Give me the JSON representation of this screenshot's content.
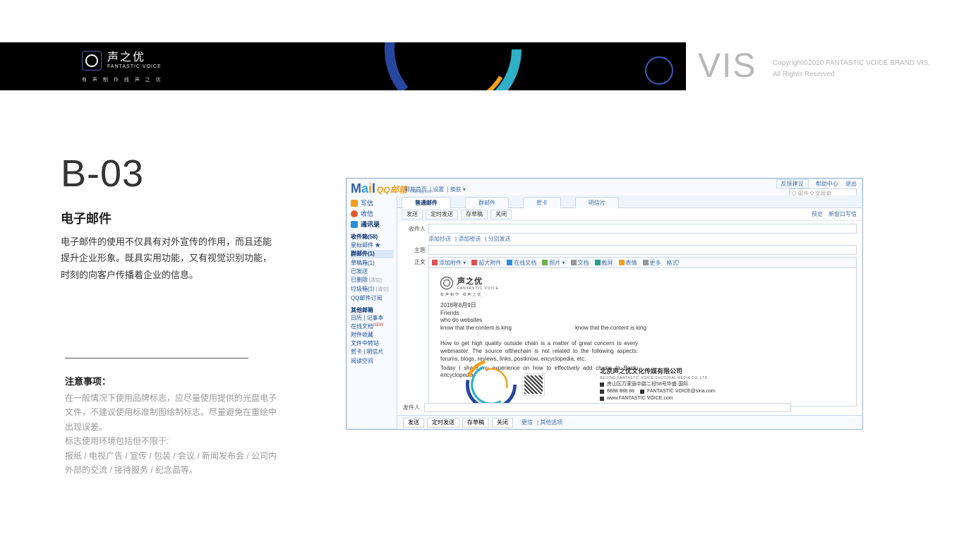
{
  "banner": {
    "brand_cn": "声之优",
    "brand_en": "FANTASTIC VOICE",
    "brand_tagline": "有 声 制 作  线 声 之 优"
  },
  "header": {
    "vis": "VIS",
    "copyright1": "Copyright©2020 FANTASTIC VOICE BRAND VIS.",
    "copyright2": "All Rights Reserved"
  },
  "page": {
    "code": "B-03",
    "title": "电子邮件",
    "desc": {
      "line1": "电子邮件的使用不仅具有对外宣传的作用，而且还能",
      "line2": "提升企业形象。既具实用功能，又有视觉识别功能，",
      "line3": "时刻的向客户传播着企业的信息。"
    },
    "notes": {
      "heading": "注意事项：",
      "p1": "在一般情况下使用品牌标志，应尽量使用提供的光盘电子文件，不建议使用标准制图绘制标志。尽量避免在重绘中出现误差。",
      "p2": "标志使用环境包括但不限于:",
      "p3": "报纸 / 电视广告 / 宣传 / 包装 / 会议 / 新闻发布会 / 公司内外部的交流 / 接待服务 / 纪念品等。"
    }
  },
  "mail": {
    "logo_cn": "QQ邮箱",
    "logo_sub": "mail.qq.com",
    "meta": [
      "邮箱首页",
      "设置",
      "换肤 ▾"
    ],
    "topbar": {
      "window": "反馈建议",
      "help": "帮助中心",
      "exit": "退出"
    },
    "search_placeholder": "Q 邮件全文搜索",
    "sidebar": {
      "actions": {
        "write": "写信",
        "inbox": "收信",
        "contacts": "通讯录"
      },
      "group1": [
        {
          "label": "收件箱(58)",
          "bold": true
        },
        {
          "label": "星标邮件 ★",
          "star": true
        },
        {
          "label": "群邮件(1)",
          "selected": true
        },
        {
          "label": "草稿箱(1)"
        },
        {
          "label": "已发送"
        },
        {
          "label": "已删除",
          "badge": "[清空]"
        },
        {
          "label": "垃圾箱(1)",
          "badge": "[清空]"
        },
        {
          "label": "QQ邮件订阅"
        }
      ],
      "section2_title": "其他邮箱",
      "group2": [
        {
          "label": "日历 | 记事本"
        },
        {
          "label": "在线文档",
          "new": "NEW"
        },
        {
          "label": "附件收藏"
        },
        {
          "label": "文件中转站"
        },
        {
          "label": "贺卡 | 明信片"
        },
        {
          "label": "阅读空间"
        }
      ]
    },
    "tabs": [
      "普通邮件",
      "群邮件",
      "贺卡",
      "明信片"
    ],
    "toolbar": {
      "send": "发送",
      "timed": "定时发送",
      "draft": "存草稿",
      "close": "关闭",
      "right1": "预览",
      "right2": "新窗口写信"
    },
    "form": {
      "to_label": "收件人",
      "sub_to": [
        "添加抄送",
        "添加密送",
        "分别发送"
      ],
      "subject_label": "主题",
      "body_label": "正文"
    },
    "editor_tools": {
      "t1": "添加附件 ▾",
      "t2": "超大附件",
      "t3": "在线文档",
      "t4": "照片 ▾",
      "t5": "文档",
      "t6": "截屏",
      "t7": "表情",
      "t8": "更多",
      "t9": "格式!"
    },
    "signature": {
      "brand_cn": "声之优",
      "brand_en": "FANTASTIC VOICE",
      "tagline": "有声制作 线声之优",
      "date": "2018年8月9日",
      "b1_l1": "Friends",
      "b1_l2": "who do websites",
      "b1_l3a": "know that the content is king",
      "b1_l3b": "know that the content is king",
      "para1": "How to get high quality outside chain is a matter of great concern to every webmaster. The source ofthechain is not related to the following aspects: forums, blogs, reviews, links, postknow, encyclopedia, etc.",
      "para2": "Today I share my experience on how to effectively add chains to Baidu encyclopedia."
    },
    "contact": {
      "company_cn": "北京声之优文化传媒有限公司",
      "company_en": "BEIJING FANTASTIC VOICE CULTURAL MEDIA CO.,LTD",
      "addr": "房山区万家丽中路二段58号华盛·国际",
      "phone": "8888 888 88",
      "email": "FANTASTIC VOICE@sina.com",
      "web": "www.FANTASTIC VOICE.com"
    },
    "footer_label": "发件人",
    "footer_bar": {
      "send": "发送",
      "timed": "定时发送",
      "draft": "存草稿",
      "close": "关闭",
      "link1": "更信",
      "link2": "其他选项"
    }
  }
}
